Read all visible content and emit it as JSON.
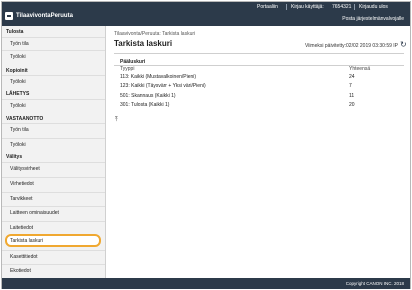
{
  "header": {
    "app_title": "TilaavivontaPeruuta",
    "portal_label": "Portaaliin",
    "user_label": "Kirjau käyttäjä:",
    "user_id": "7654321",
    "logout_label": "Kirjaudu ulos",
    "mail_link": "Posta järjestelmänvalvojalle"
  },
  "sidebar": {
    "sections": [
      {
        "title": "Tulosta",
        "items": [
          "Työn tila",
          "Työloki"
        ]
      },
      {
        "title": "Kopioinit",
        "items": [
          "Työloki"
        ]
      },
      {
        "title": "LÄHETYS",
        "items": [
          "Työloki"
        ]
      },
      {
        "title": "VASTAANOTTO",
        "items": [
          "Työn tila",
          "Työloki"
        ]
      },
      {
        "title": "Välitys",
        "items": [
          "Välitysvirheet",
          "Virhetiedot",
          "Tarvikkeet",
          "Laitteen ominaisuudet",
          "Laitetiedot",
          "Tarkista laskuri",
          "Kasettitiedot",
          "Ekotiedot"
        ]
      }
    ]
  },
  "main": {
    "breadcrumb": "Tilaavivonta/Peruuta: Tarkista laskuri",
    "title": "Tarkista laskuri",
    "updated": "Viimeksi päivitetty:02/02 2019 03:30:59 IP",
    "section_title": "Pääluskuri",
    "columns": [
      "Tyyppi",
      "Yhteensä"
    ],
    "rows": [
      {
        "type": "113: Kaikki (Mustavalkoinen/Pieni)",
        "total": "24"
      },
      {
        "type": "123: Kaikki (Täysvärr + Yksi väri/Pieni)",
        "total": "7"
      },
      {
        "type": "501: Skannaus (Kaikki 1)",
        "total": "11"
      },
      {
        "type": "301: Tulosta (Kaikki 1)",
        "total": "20"
      }
    ]
  },
  "footer": {
    "copyright": "Copyright CANON INC. 2018"
  },
  "icons": {
    "refresh": "refresh-icon",
    "back": "back-to-top-icon"
  }
}
